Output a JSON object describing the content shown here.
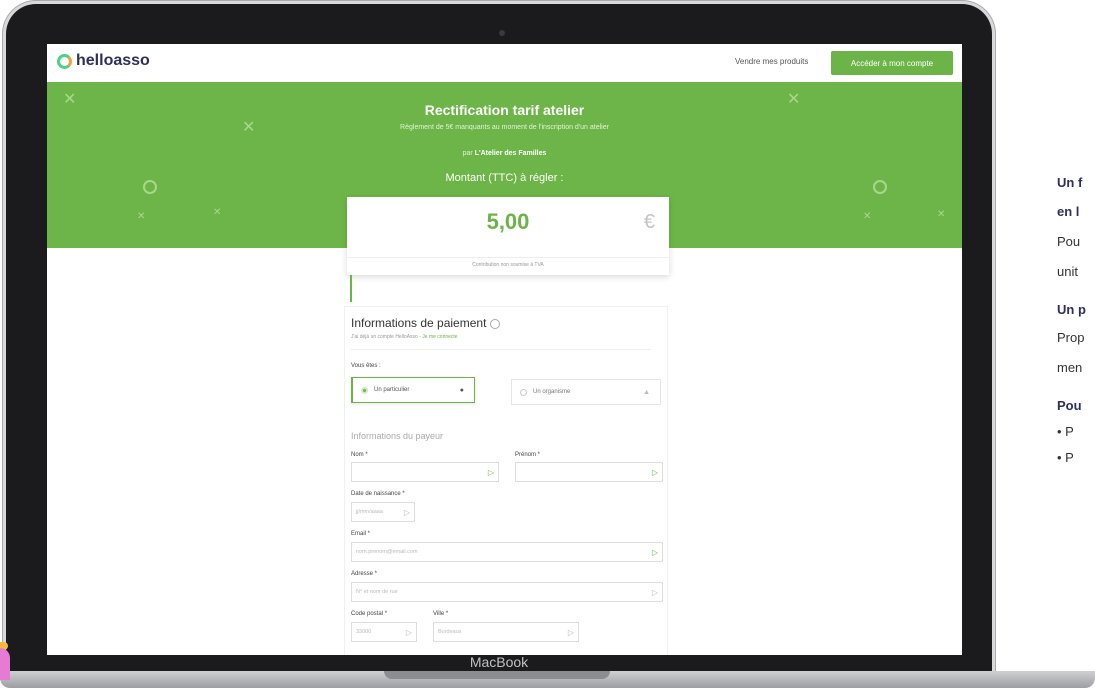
{
  "device_label": "MacBook",
  "nav": {
    "logo": "helloasso",
    "link": "Vendre mes produits",
    "cta": "Accéder à mon compte"
  },
  "banner": {
    "title": "Rectification tarif atelier",
    "subtitle": "Règlement de 5€ manquants au moment de l'inscription d'un atelier",
    "by_prefix": "par",
    "by_org": "L'Atelier des Familles",
    "amount_label": "Montant (TTC) à régler :"
  },
  "amount": {
    "value": "5,00",
    "currency": "€",
    "note": "Contribution non soumise à TVA"
  },
  "form": {
    "title": "Informations de paiement",
    "login_text": "J'ai déjà un compte HelloAsso -",
    "login_link": "Je me connecte",
    "you_are": "Vous êtes :",
    "choice_individual": "Un particulier",
    "choice_org": "Un organisme",
    "payer_section": "Informations du payeur",
    "lastname_label": "Nom *",
    "firstname_label": "Prénom *",
    "birthdate_label": "Date de naissance *",
    "birthdate_placeholder": "jj/mm/aaaa",
    "email_label": "Email *",
    "email_placeholder": "nom.prenom@email.com",
    "address_label": "Adresse *",
    "address_placeholder": "N° et nom de rue",
    "zip_label": "Code postal *",
    "zip_placeholder": "33000",
    "city_label": "Ville *",
    "city_placeholder": "Bordeaux"
  },
  "side": {
    "line1": "Un f",
    "line2": "en l",
    "line3": "Pou",
    "line4": "unit",
    "line5": "Un p",
    "line6": "Prop",
    "line7": "men",
    "line8": "Pou",
    "bullet1": "P",
    "bullet2": "P"
  },
  "colors": {
    "brand_green": "#6cb448",
    "logo_navy": "#2e2f5e"
  }
}
